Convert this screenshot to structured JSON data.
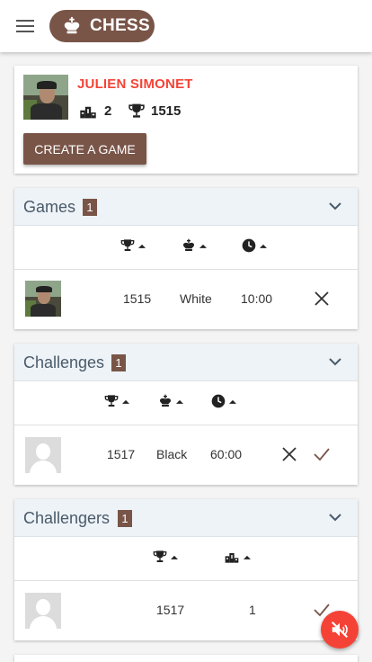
{
  "app": {
    "title": "CHESS",
    "brand_icon": "chess-king-icon",
    "menu_icon": "menu-icon"
  },
  "profile": {
    "name": "JULIEN SIMONET",
    "games_won": "2",
    "rating": "1515",
    "create_button": "CREATE A GAME",
    "name_color": "#f44336"
  },
  "games": {
    "title": "Games",
    "count": "1",
    "columns": [
      "rating",
      "color",
      "time"
    ],
    "rows": [
      {
        "rating": "1515",
        "color": "White",
        "time": "10:00"
      }
    ]
  },
  "challenges": {
    "title": "Challenges",
    "count": "1",
    "columns": [
      "rating",
      "color",
      "time"
    ],
    "rows": [
      {
        "rating": "1517",
        "color": "Black",
        "time": "60:00"
      }
    ]
  },
  "challengers": {
    "title": "Challengers",
    "count": "1",
    "columns": [
      "rating",
      "podium"
    ],
    "rows": [
      {
        "rating": "1517",
        "wins": "1"
      }
    ]
  },
  "sound_button_icon": "volume-off-icon",
  "colors": {
    "brand": "#795548",
    "accent": "#f44336",
    "header_bg": "#edf3f7"
  }
}
